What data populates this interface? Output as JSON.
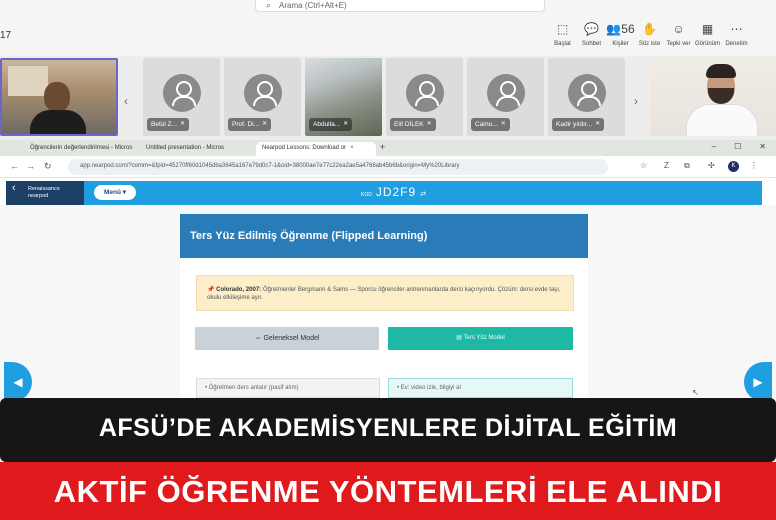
{
  "teams": {
    "search_placeholder": "Arama (Ctrl+Alt+E)",
    "timer": "17",
    "actions": [
      {
        "icon": "share-screen-icon",
        "glyph": "⬚",
        "label": "Başlat"
      },
      {
        "icon": "chat-icon",
        "glyph": "💬",
        "label": "Sohbet"
      },
      {
        "icon": "people-icon",
        "glyph": "👥56",
        "label": "Kişiler"
      },
      {
        "icon": "raise-hand-icon",
        "glyph": "✋",
        "label": "Söz iste"
      },
      {
        "icon": "react-icon",
        "glyph": "☺",
        "label": "Tepki ver"
      },
      {
        "icon": "view-icon",
        "glyph": "▦",
        "label": "Görünüm"
      },
      {
        "icon": "more-icon",
        "glyph": "⋯",
        "label": "Denetim"
      }
    ],
    "participants": [
      "Betül Z...",
      "Prof. Di...",
      "Abdulla...",
      "Elif DİLEK",
      "Camu...",
      "Kadir yıldır..."
    ]
  },
  "browser": {
    "tabs": [
      {
        "label": "Öğrencilerin değerlendirilmesi - Micros",
        "active": false
      },
      {
        "label": "Untitled presentation - Micros",
        "active": false
      },
      {
        "label": "Nearpod Lessons: Download or",
        "active": true
      }
    ],
    "url": "app.nearpod.com/?comm=&fpid=45270ff60d1045dba3645a167e79d0c7-1&oid=38000ae7e77c22ea2ae5a4768ab45b6b&origin=My%20Library",
    "profile_initial": "K"
  },
  "nearpod": {
    "brand_line1": "Renaissance",
    "brand_line2": "nearpod",
    "menu_label": "Menü ▾",
    "code_key": "KOD",
    "code_value": "JD2F9",
    "code_share": "⇄"
  },
  "slide": {
    "title": "Ters Yüz Edilmiş Öğrenme (Flipped Learning)",
    "note_bold": "Colorado, 2007:",
    "note_text": " Öğretmenler Bergmann & Sams — Sporcu öğrenciler antrenmanlarda dersi kaçırıyordu. Çözüm: dersi evde taşı, okulu etkileşime ayır.",
    "button_general": "⇔ Geleneksel Model",
    "button_flipped": "▤ Ters Yüz Model",
    "card_left": "• Öğretmen ders anlatır (pasif alım)",
    "card_right": "• Ev: video izle, bilgiyi al"
  },
  "headline": {
    "line1": "AFSÜ’DE AKADEMİSYENLERE DİJİTAL EĞİTİM",
    "line2": "AKTİF ÖĞRENME YÖNTEMLERİ ELE ALINDI"
  }
}
